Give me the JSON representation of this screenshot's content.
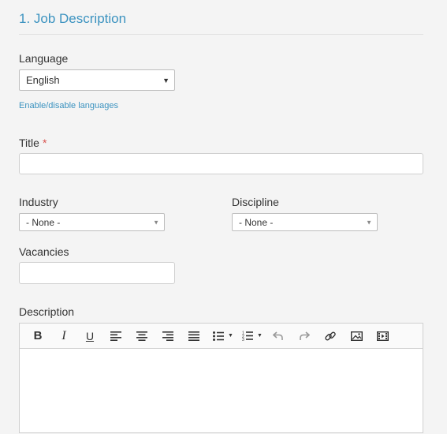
{
  "section": {
    "title": "1. Job Description"
  },
  "language": {
    "label": "Language",
    "selected": "English",
    "toggle_link": "Enable/disable languages"
  },
  "title_field": {
    "label": "Title",
    "required_mark": "*",
    "value": ""
  },
  "industry": {
    "label": "Industry",
    "selected": "- None -"
  },
  "discipline": {
    "label": "Discipline",
    "selected": "- None -"
  },
  "vacancies": {
    "label": "Vacancies",
    "value": ""
  },
  "description": {
    "label": "Description",
    "toolbar": [
      "bold-icon",
      "italic-icon",
      "underline-icon",
      "align-left-icon",
      "align-center-icon",
      "align-right-icon",
      "align-justify-icon",
      "bullet-list-icon",
      "numbered-list-icon",
      "undo-icon",
      "redo-icon",
      "link-icon",
      "image-icon",
      "media-icon"
    ]
  },
  "colors": {
    "accent": "#3c93c0",
    "required": "#d9534f",
    "background": "#f4f4f4"
  }
}
